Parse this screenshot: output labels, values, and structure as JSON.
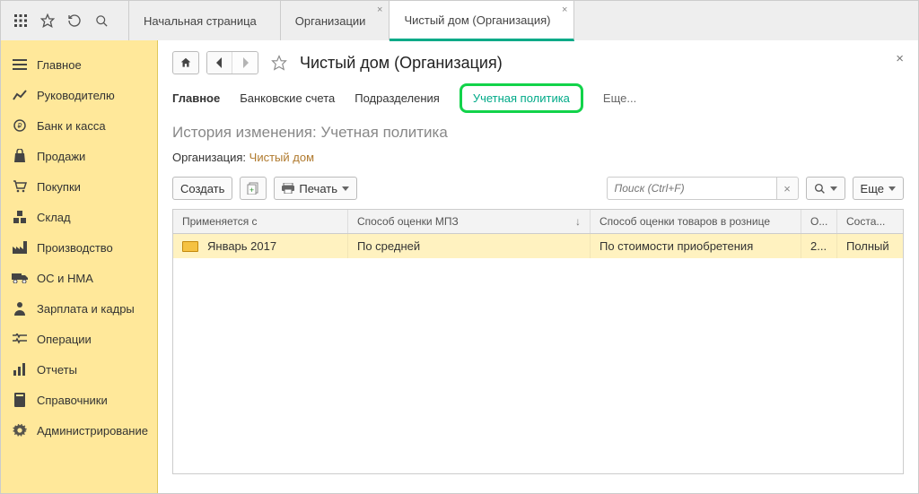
{
  "topbar": {
    "tabs": [
      {
        "label": "Начальная страница",
        "closable": false
      },
      {
        "label": "Организации",
        "closable": true
      },
      {
        "label": "Чистый дом (Организация)",
        "closable": true,
        "active": true
      }
    ]
  },
  "sidebar": {
    "items": [
      {
        "label": "Главное",
        "icon": "menu"
      },
      {
        "label": "Руководителю",
        "icon": "chart"
      },
      {
        "label": "Банк и касса",
        "icon": "coin"
      },
      {
        "label": "Продажи",
        "icon": "bag"
      },
      {
        "label": "Покупки",
        "icon": "cart"
      },
      {
        "label": "Склад",
        "icon": "boxes"
      },
      {
        "label": "Производство",
        "icon": "factory"
      },
      {
        "label": "ОС и НМА",
        "icon": "truck"
      },
      {
        "label": "Зарплата и кадры",
        "icon": "person"
      },
      {
        "label": "Операции",
        "icon": "ops"
      },
      {
        "label": "Отчеты",
        "icon": "bars"
      },
      {
        "label": "Справочники",
        "icon": "book"
      },
      {
        "label": "Администрирование",
        "icon": "gear"
      }
    ]
  },
  "page": {
    "title": "Чистый дом (Организация)",
    "subtabs": {
      "main": "Главное",
      "bank": "Банковские счета",
      "dept": "Подразделения",
      "policy": "Учетная политика",
      "more": "Еще..."
    },
    "subtitle": "История изменения: Учетная политика",
    "org_label": "Организация:",
    "org_value": "Чистый дом",
    "toolbar": {
      "create": "Создать",
      "print": "Печать",
      "search_placeholder": "Поиск (Ctrl+F)",
      "more": "Еще"
    },
    "table": {
      "headers": {
        "date": "Применяется с",
        "mpz": "Способ оценки МПЗ",
        "retail": "Способ оценки товаров в рознице",
        "o": "О...",
        "sost": "Соста..."
      },
      "rows": [
        {
          "date": "Январь 2017",
          "mpz": "По средней",
          "retail": "По стоимости приобретения",
          "o": "2...",
          "sost": "Полный"
        }
      ]
    }
  }
}
